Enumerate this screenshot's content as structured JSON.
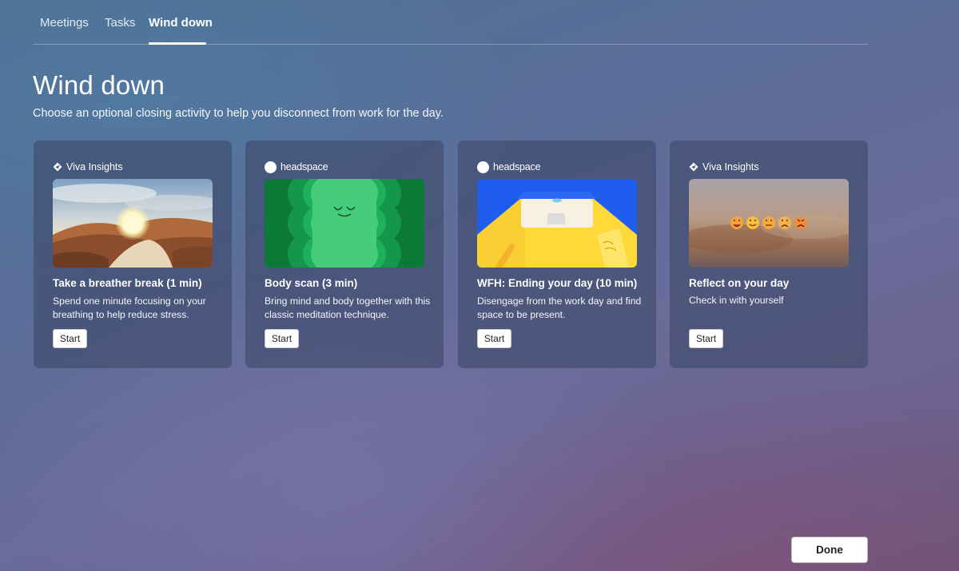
{
  "tabs": [
    {
      "label": "Meetings",
      "active": false
    },
    {
      "label": "Tasks",
      "active": false
    },
    {
      "label": "Wind down",
      "active": true
    }
  ],
  "page": {
    "title": "Wind down",
    "subtitle": "Choose an optional closing activity to help you disconnect from work for the day."
  },
  "cards": [
    {
      "provider": "Viva Insights",
      "provider_icon": "viva-insights-icon",
      "image": "desert-sunset-landscape",
      "title": "Take a breather break (1 min)",
      "description": "Spend one minute focusing on your breathing to help reduce stress.",
      "button_label": "Start"
    },
    {
      "provider": "headspace",
      "provider_icon": "headspace-logo-dot",
      "image": "green-blob-character",
      "title": "Body scan (3 min)",
      "description": "Bring mind and body together with this classic meditation technique.",
      "button_label": "Start"
    },
    {
      "provider": "headspace",
      "provider_icon": "headspace-logo-dot",
      "image": "laptop-desk-illustration",
      "title": "WFH: Ending your day (10 min)",
      "description": "Disengage from the work day and find space to be present.",
      "button_label": "Start"
    },
    {
      "provider": "Viva Insights",
      "provider_icon": "viva-insights-icon",
      "image": "blurred-emoji-mood-scale",
      "title": "Reflect on your day",
      "description": "Check in with yourself",
      "button_label": "Start"
    }
  ],
  "footer": {
    "done_label": "Done"
  },
  "colors": {
    "card_bg": "#3e4869",
    "headspace_green": "#2eb35f",
    "headspace_blue": "#1f5cf0",
    "headspace_yellow": "#ffd83a"
  }
}
